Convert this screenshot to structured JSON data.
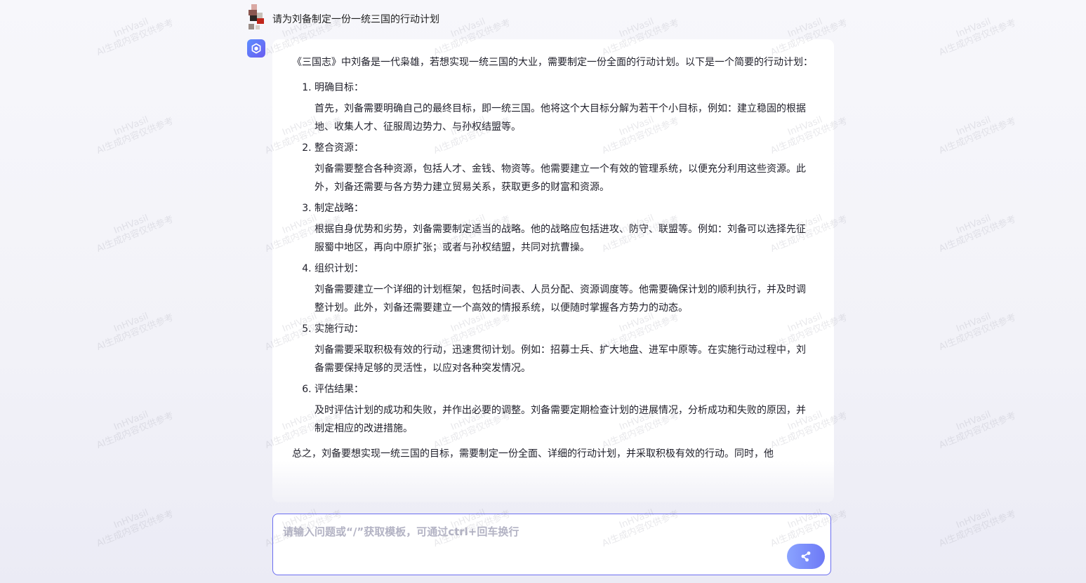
{
  "watermark": {
    "line1": "InHVasil",
    "line2": "AI生成内容仅供参考"
  },
  "user": {
    "question": "请为刘备制定一份一统三国的行动计划"
  },
  "answer": {
    "intro": "《三国志》中刘备是一代枭雄，若想实现一统三国的大业，需要制定一份全面的行动计划。以下是一个简要的行动计划：",
    "steps": [
      {
        "title": "明确目标：",
        "body": "首先，刘备需要明确自己的最终目标，即一统三国。他将这个大目标分解为若干个小目标，例如：建立稳固的根据地、收集人才、征服周边势力、与孙权结盟等。"
      },
      {
        "title": "整合资源：",
        "body": "刘备需要整合各种资源，包括人才、金钱、物资等。他需要建立一个有效的管理系统，以便充分利用这些资源。此外，刘备还需要与各方势力建立贸易关系，获取更多的财富和资源。"
      },
      {
        "title": "制定战略：",
        "body": "根据自身优势和劣势，刘备需要制定适当的战略。他的战略应包括进攻、防守、联盟等。例如：刘备可以选择先征服蜀中地区，再向中原扩张；或者与孙权结盟，共同对抗曹操。"
      },
      {
        "title": "组织计划：",
        "body": "刘备需要建立一个详细的计划框架，包括时间表、人员分配、资源调度等。他需要确保计划的顺利执行，并及时调整计划。此外，刘备还需要建立一个高效的情报系统，以便随时掌握各方势力的动态。"
      },
      {
        "title": "实施行动：",
        "body": "刘备需要采取积极有效的行动，迅速贯彻计划。例如：招募士兵、扩大地盘、进军中原等。在实施行动过程中，刘备需要保持足够的灵活性，以应对各种突发情况。"
      },
      {
        "title": "评估结果：",
        "body": "及时评估计划的成功和失败，并作出必要的调整。刘备需要定期检查计划的进展情况，分析成功和失败的原因，并制定相应的改进措施。"
      }
    ],
    "summary": "总之，刘备要想实现一统三国的目标，需要制定一份全面、详细的行动计划，并采取积极有效的行动。同时，他"
  },
  "input": {
    "placeholder": "请输入问题或“/”获取模板，可通过ctrl+回车换行",
    "value": ""
  },
  "icons": {
    "bot": "bot-logo-icon",
    "send": "send-icon"
  },
  "colors": {
    "accent": "#6b6ef0",
    "bot_avatar_start": "#5c8dff",
    "bot_avatar_end": "#6a5cf0"
  }
}
